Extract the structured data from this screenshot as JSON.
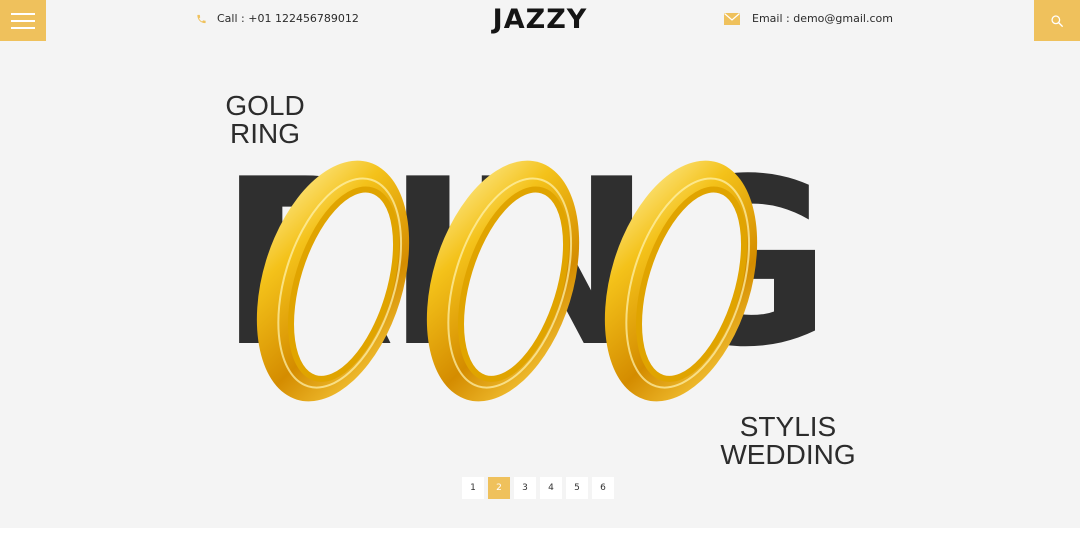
{
  "header": {
    "logo": "JAZZY",
    "call_text": "Call : +01 122456789012",
    "email_text": "Email : demo@gmail.com"
  },
  "hero": {
    "big_word": "RING",
    "caption_top_line1": "GOLD",
    "caption_top_line2": "RING",
    "caption_bottom_line1": "STYLIS",
    "caption_bottom_line2": "WEDDING"
  },
  "pagination": {
    "pages": [
      "1",
      "2",
      "3",
      "4",
      "5",
      "6"
    ],
    "active_page": "2"
  },
  "colors": {
    "accent": "#efc15c",
    "background": "#f4f4f4",
    "text_dark": "#2f2f2f"
  },
  "icons": {
    "menu": "hamburger-menu-icon",
    "search": "search-icon",
    "phone": "phone-icon",
    "email": "envelope-icon"
  }
}
